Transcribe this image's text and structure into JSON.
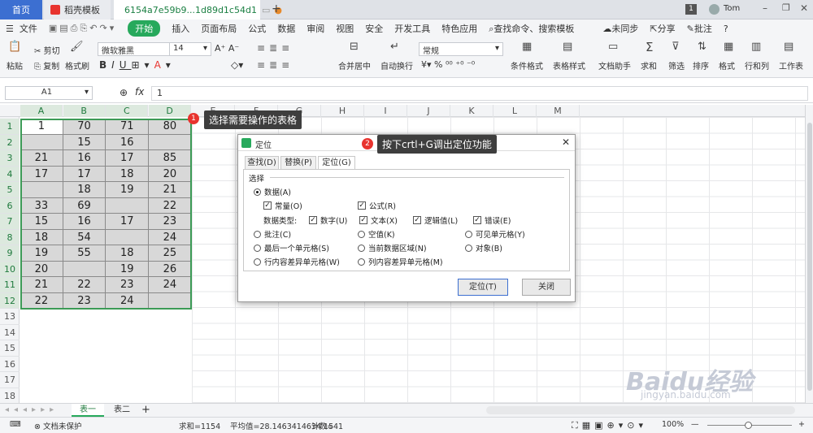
{
  "titlebar": {
    "home_tab": "首页",
    "template_tab": "稻壳模板",
    "file_tab": "6154a7e59b9...1d89d1c54d1",
    "add_tab": "+",
    "badge_num": "1",
    "user": "Tom"
  },
  "menubar": {
    "file": "文件",
    "items": [
      "开始",
      "插入",
      "页面布局",
      "公式",
      "数据",
      "审阅",
      "视图",
      "安全",
      "开发工具",
      "特色应用"
    ],
    "search": "查找命令、搜索模板",
    "sync": "未同步",
    "share": "分享",
    "comment": "批注"
  },
  "ribbon": {
    "paste": "粘贴",
    "cut": "剪切",
    "copy": "复制",
    "format_painter": "格式刷",
    "font": "微软雅黑",
    "size": "14",
    "merge": "合并居中",
    "wrap": "自动换行",
    "num_format": "常规",
    "cond_format": "条件格式",
    "table_style": "表格样式",
    "doc_helper": "文档助手",
    "sum": "求和",
    "filter": "筛选",
    "sort": "排序",
    "format": "格式",
    "rowcol": "行和列",
    "worksheet": "工作表"
  },
  "formula": {
    "cell_ref": "A1",
    "fx": "fx",
    "value": "1"
  },
  "grid": {
    "columns": [
      "A",
      "B",
      "C",
      "D",
      "E",
      "F",
      "G",
      "H",
      "I",
      "J",
      "K",
      "L",
      "M"
    ],
    "rows": [
      "1",
      "2",
      "3",
      "4",
      "5",
      "6",
      "7",
      "8",
      "9",
      "10",
      "11",
      "12",
      "13",
      "14",
      "15",
      "16",
      "17",
      "18"
    ],
    "data": [
      [
        "1",
        "70",
        "71",
        "80"
      ],
      [
        "",
        "15",
        "16",
        ""
      ],
      [
        "21",
        "16",
        "17",
        "85"
      ],
      [
        "17",
        "17",
        "18",
        "20"
      ],
      [
        "",
        "18",
        "19",
        "21"
      ],
      [
        "33",
        "69",
        "",
        "22"
      ],
      [
        "15",
        "16",
        "17",
        "23"
      ],
      [
        "18",
        "54",
        "",
        "24"
      ],
      [
        "19",
        "55",
        "18",
        "25"
      ],
      [
        "20",
        "",
        "19",
        "26"
      ],
      [
        "21",
        "22",
        "23",
        "24"
      ],
      [
        "22",
        "23",
        "24",
        ""
      ]
    ]
  },
  "annotations": {
    "step1_num": "1",
    "step1": "选择需要操作的表格",
    "step2_num": "2",
    "step2": "按下crtl+G调出定位功能"
  },
  "dialog": {
    "title": "定位",
    "tabs": [
      "查找(D)",
      "替换(P)",
      "定位(G)"
    ],
    "section": "选择",
    "data": "数据(A)",
    "constant": "常量(O)",
    "formula": "公式(R)",
    "data_type": "数据类型:",
    "number": "数字(U)",
    "text": "文本(X)",
    "logical": "逻辑值(L)",
    "error": "错误(E)",
    "comment": "批注(C)",
    "blank": "空值(K)",
    "visible": "可见单元格(Y)",
    "last_cell": "最后一个单元格(S)",
    "current_region": "当前数据区域(N)",
    "object": "对象(B)",
    "row_diff": "行内容差异单元格(W)",
    "col_diff": "列内容差异单元格(M)",
    "goto_btn": "定位(T)",
    "close_btn": "关闭"
  },
  "sheets": {
    "sheet1": "表一",
    "sheet2": "表二",
    "add": "+"
  },
  "status": {
    "protect": "文档未保护",
    "sum": "求和=1154",
    "avg": "平均值=28.1463414634 15",
    "count": "计数=41",
    "zoom": "100%"
  },
  "watermark": {
    "brand": "Baidu经验",
    "url": "jingyan.baidu.com"
  },
  "colors": {
    "accent_green": "#27a95c",
    "home_blue": "#3c6fd1",
    "badge_red": "#e8332e",
    "selection": "#3c9b56"
  }
}
